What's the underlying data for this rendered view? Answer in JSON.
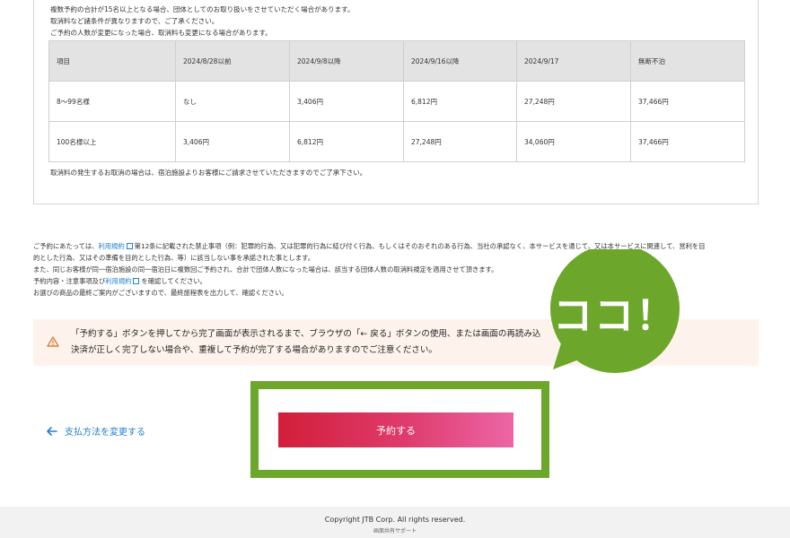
{
  "notes": [
    "複数予約の合計が15名以上となる場合、団体としてのお取り扱いをさせていただく場合があります。",
    "取消料など諸条件が異なりますので、ご了承ください。",
    "ご予約の人数が変更になった場合、取消料も変更になる場合があります。"
  ],
  "fee_table": {
    "headers": [
      "項目",
      "2024/8/28以前",
      "2024/9/8以降",
      "2024/9/16以降",
      "2024/9/17",
      "無断不泊"
    ],
    "rows": [
      [
        "8～99名様",
        "なし",
        "3,406円",
        "6,812円",
        "27,248円",
        "37,466円"
      ],
      [
        "100名様以上",
        "3,406円",
        "6,812円",
        "27,248円",
        "34,060円",
        "37,466円"
      ]
    ]
  },
  "cancel_note": "取消料の発生するお取消の場合は、宿泊施設よりお客様にご請求させていただきますのでご了承下さい。",
  "terms": {
    "l1_a": "ご予約にあたっては、",
    "l1_link": "利用規約",
    "l1_b": "第12条に記載された禁止事項（例：犯罪的行為、又は犯罪的行為に結び付く行為、もしくはそのおそれのある行為、当社の承認なく、本サービスを通じて、又は本サービスに関連して、営利を目",
    "l2": "的とした行為、又はその準備を目的とした行為、等）に該当しない事を承諾された事とします。",
    "l3": "また、同じお客様が同一宿泊施設の同一宿泊日に複数回ご予約され、合計で団体人数になった場合は、該当する団体人数の取消料規定を適用させて頂きます。",
    "l4_a": "予約内容・注意事項及び",
    "l4_link": "利用規約",
    "l4_b": "を確認してください。",
    "l5": "お選びの商品の最終ご案内がございますので、最終旅程表を出力して、確認ください。"
  },
  "warning": {
    "line1": "「予約する」ボタンを押してから完了画面が表示されるまで、ブラウザの「← 戻る」ボタンの使用、または画面の再読み込",
    "line2": "決済が正しく完了しない場合や、重複して予約が完了する場合がありますのでご注意ください。"
  },
  "back_link": "支払方法を変更する",
  "reserve_button": "予約する",
  "callout": "ココ！",
  "footer": {
    "copyright": "Copyright JTB Corp. All rights reserved.",
    "support": "画面共有サポート"
  },
  "colors": {
    "highlight": "#6ca62a",
    "link": "#1f7fd0",
    "button_start": "#d21e3a",
    "button_end": "#ec66a6",
    "warning_bg": "#fdf3ec",
    "warning_icon": "#e0803a"
  }
}
